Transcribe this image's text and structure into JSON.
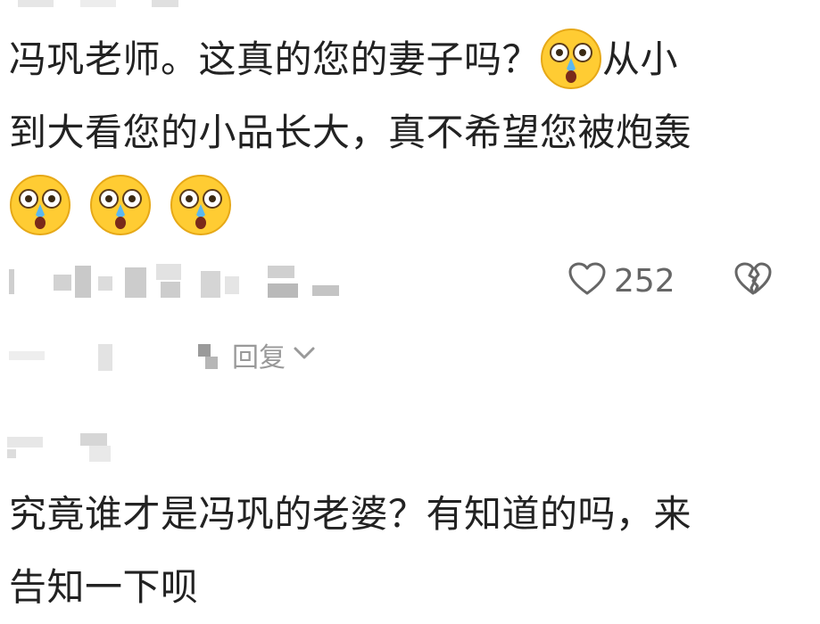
{
  "comment_1": {
    "line_1": "冯巩老师。这真的您的妻子吗？",
    "line_1_after_emoji": "从小",
    "line_2": "到大看您的小品长大，真不希望您被炮轰",
    "emoji_name": "crying-shocked-face-emoji"
  },
  "actions": {
    "like_count": "252",
    "like_icon": "heart-outline-icon",
    "dislike_icon": "broken-heart-icon"
  },
  "replies": {
    "label": "回复"
  },
  "comment_2": {
    "line_1": "究竟谁才是冯巩的老婆？有知道的吗，来",
    "line_2": "告知一下呗"
  },
  "colors": {
    "text": "#222222",
    "muted": "#999999",
    "icon": "#666666",
    "emoji_face": "#FFCC33"
  }
}
